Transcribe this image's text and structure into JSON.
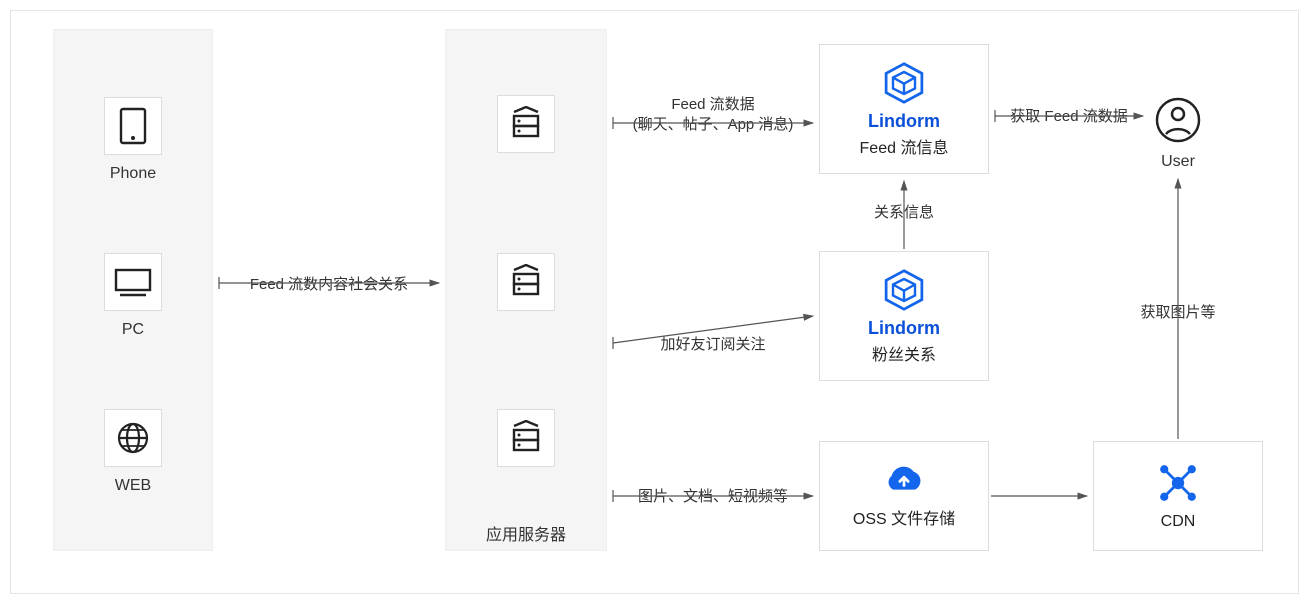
{
  "clients": {
    "phone": "Phone",
    "pc": "PC",
    "web": "WEB"
  },
  "appServer": {
    "label": "应用服务器"
  },
  "lindormFeed": {
    "title": "Lindorm",
    "subtitle": "Feed 流信息"
  },
  "lindormFans": {
    "title": "Lindorm",
    "subtitle": "粉丝关系"
  },
  "oss": {
    "label": "OSS 文件存储"
  },
  "cdn": {
    "label": "CDN"
  },
  "user": {
    "label": "User"
  },
  "edges": {
    "clientsToApp": "Feed 流数内容社会关系",
    "appToFeedL1": "Feed 流数据",
    "appToFeedL2": "(聊天、帖子、App 消息)",
    "appToFans": "加好友订阅关注",
    "appToOss": "图片、文档、短视频等",
    "fansToFeed": "关系信息",
    "feedToUser": "获取 Feed 流数据",
    "cdnToUser": "获取图片等"
  }
}
